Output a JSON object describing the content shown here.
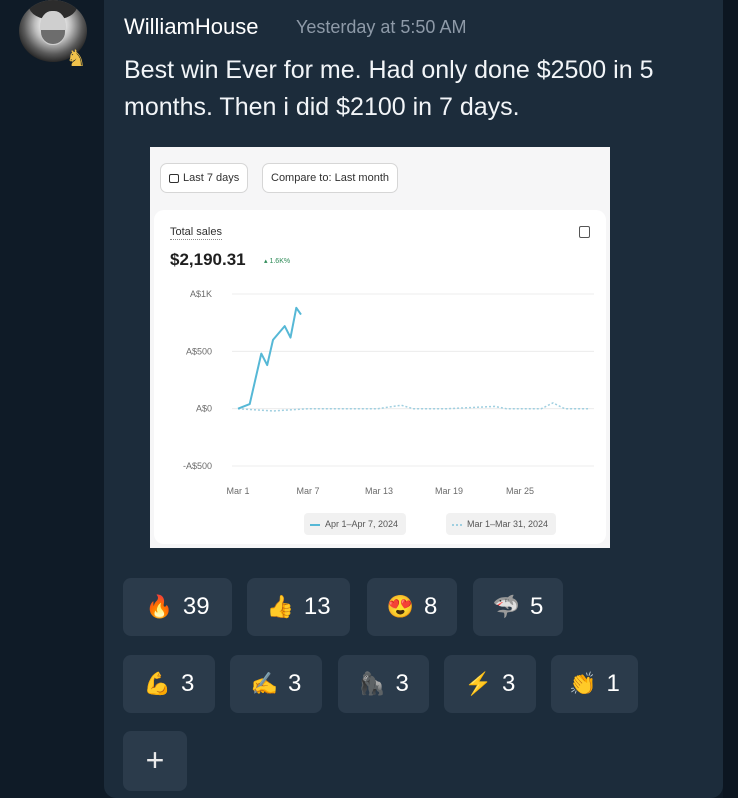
{
  "message": {
    "author": "WilliamHouse",
    "timestamp": "Yesterday at 5:50 AM",
    "text": "Best win Ever for me. Had only done $2500 in 5 months. Then i did $2100 in 7 days.",
    "badge_icon": "chess-knight-icon"
  },
  "embedded_image": {
    "date_filter": "Last 7 days",
    "compare_filter": "Compare to: Last month",
    "metric_label": "Total sales",
    "metric_value": "$2,190.31",
    "metric_change": "1.6K%",
    "chart_data": {
      "type": "line",
      "y_ticks": [
        "A$1K",
        "A$500",
        "A$0",
        "-A$500"
      ],
      "x_ticks": [
        "Mar 1",
        "Mar 7",
        "Mar 13",
        "Mar 19",
        "Mar 25"
      ],
      "ylim": [
        -500,
        1000
      ],
      "series": [
        {
          "name": "Apr 1–Apr 7, 2024",
          "style": "solid",
          "color": "#56b8d6",
          "points": [
            [
              1,
              0
            ],
            [
              2,
              40
            ],
            [
              3,
              480
            ],
            [
              3.5,
              380
            ],
            [
              4,
              600
            ],
            [
              5,
              720
            ],
            [
              5.5,
              620
            ],
            [
              6,
              880
            ],
            [
              6.4,
              820
            ]
          ]
        },
        {
          "name": "Mar 1–Mar 31, 2024",
          "style": "dotted",
          "color": "#9fcfe0",
          "points": [
            [
              1,
              0
            ],
            [
              4,
              -20
            ],
            [
              7,
              0
            ],
            [
              10,
              0
            ],
            [
              13,
              0
            ],
            [
              15,
              30
            ],
            [
              16,
              0
            ],
            [
              19,
              0
            ],
            [
              23,
              20
            ],
            [
              24,
              0
            ],
            [
              27,
              0
            ],
            [
              28,
              50
            ],
            [
              29,
              0
            ],
            [
              31,
              0
            ]
          ]
        }
      ]
    }
  },
  "reactions": [
    {
      "emoji": "🔥",
      "icon": "fire-icon",
      "count": "39"
    },
    {
      "emoji": "👍",
      "icon": "thumbs-up-icon",
      "count": "13"
    },
    {
      "emoji": "😍",
      "icon": "heart-eyes-icon",
      "count": "8"
    },
    {
      "emoji": "🦈",
      "icon": "shark-icon",
      "count": "5"
    },
    {
      "emoji": "💪",
      "icon": "flexed-biceps-icon",
      "count": "3"
    },
    {
      "emoji": "✍",
      "icon": "writing-hand-icon",
      "count": "3"
    },
    {
      "emoji": "🦍",
      "icon": "gorilla-icon",
      "count": "3"
    },
    {
      "emoji": "⚡",
      "icon": "lightning-icon",
      "count": "3"
    },
    {
      "emoji": "👏",
      "icon": "clapping-hands-icon",
      "count": "1"
    }
  ],
  "add_reaction_label": "+"
}
